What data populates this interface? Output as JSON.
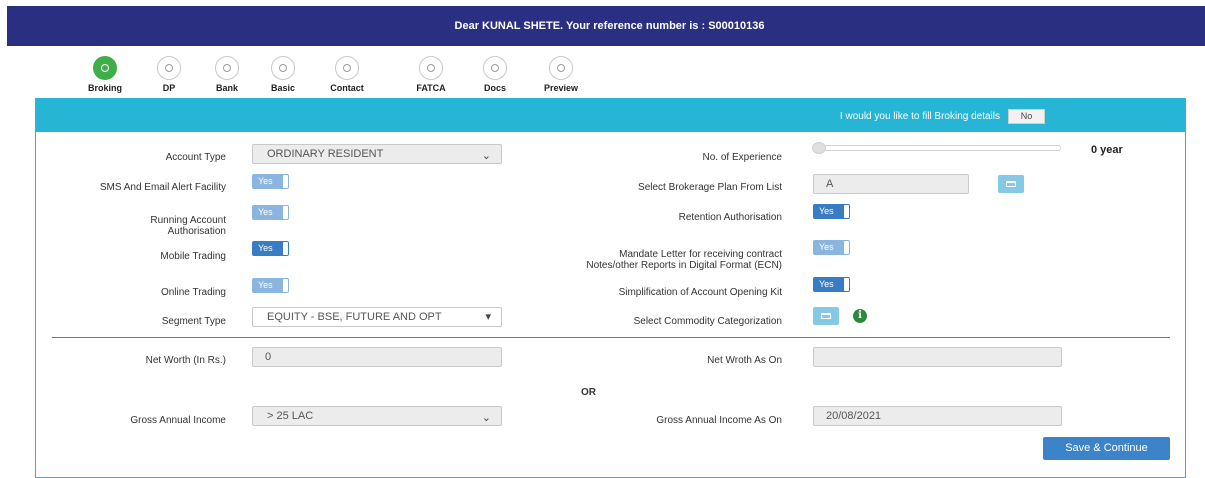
{
  "banner": {
    "text": "Dear KUNAL SHETE. Your reference number is : S00010136"
  },
  "steps": [
    {
      "label": "Broking",
      "active": true
    },
    {
      "label": "DP",
      "active": false
    },
    {
      "label": "Bank",
      "active": false
    },
    {
      "label": "Basic",
      "active": false
    },
    {
      "label": "Contact",
      "active": false
    },
    {
      "label": "FATCA",
      "active": false
    },
    {
      "label": "Docs",
      "active": false
    },
    {
      "label": "Preview",
      "active": false
    }
  ],
  "panel": {
    "question": "I would you like to fill Broking details",
    "toggle_label": "No"
  },
  "left": {
    "account_type_label": "Account Type",
    "account_type_value": "ORDINARY RESIDENT",
    "sms_label": "SMS And Email Alert Facility",
    "sms_value": "Yes",
    "running_label_1": "Running Account",
    "running_label_2": "Authorisation",
    "running_value": "Yes",
    "mobile_label": "Mobile Trading",
    "mobile_value": "Yes",
    "online_label": "Online Trading",
    "online_value": "Yes",
    "segment_label": "Segment Type",
    "segment_value": "EQUITY - BSE, FUTURE AND OPT"
  },
  "right": {
    "experience_label": "No. of Experience",
    "experience_value": "0 year",
    "experience_level": 0,
    "brokerage_label": "Select Brokerage Plan From List",
    "brokerage_value": "A",
    "retention_label": "Retention Authorisation",
    "retention_value": "Yes",
    "mandate_label_1": "Mandate Letter for receiving contract",
    "mandate_label_2": "Notes/other Reports in Digital Format (ECN)",
    "mandate_value": "Yes",
    "simplification_label": "Simplification of Account Opening Kit",
    "simplification_value": "Yes",
    "commodity_label": "Select Commodity Categorization"
  },
  "finance": {
    "net_worth_label": "Net Worth (In Rs.)",
    "net_worth_value": "0",
    "net_worth_as_on_label": "Net Wroth As On",
    "net_worth_as_on_value": "",
    "or_label": "OR",
    "gross_label": "Gross Annual Income",
    "gross_value": "> 25 LAC",
    "gross_as_on_label": "Gross Annual Income As On",
    "gross_as_on_value": "20/08/2021"
  },
  "actions": {
    "save_label": "Save & Continue"
  },
  "colors": {
    "banner": "#2b2f82",
    "panel_header": "#27b5d6",
    "active_step": "#3fae49",
    "toggle_dark": "#3a7cc4",
    "toggle_light": "#8ab5de",
    "save_button": "#3c83c9"
  }
}
